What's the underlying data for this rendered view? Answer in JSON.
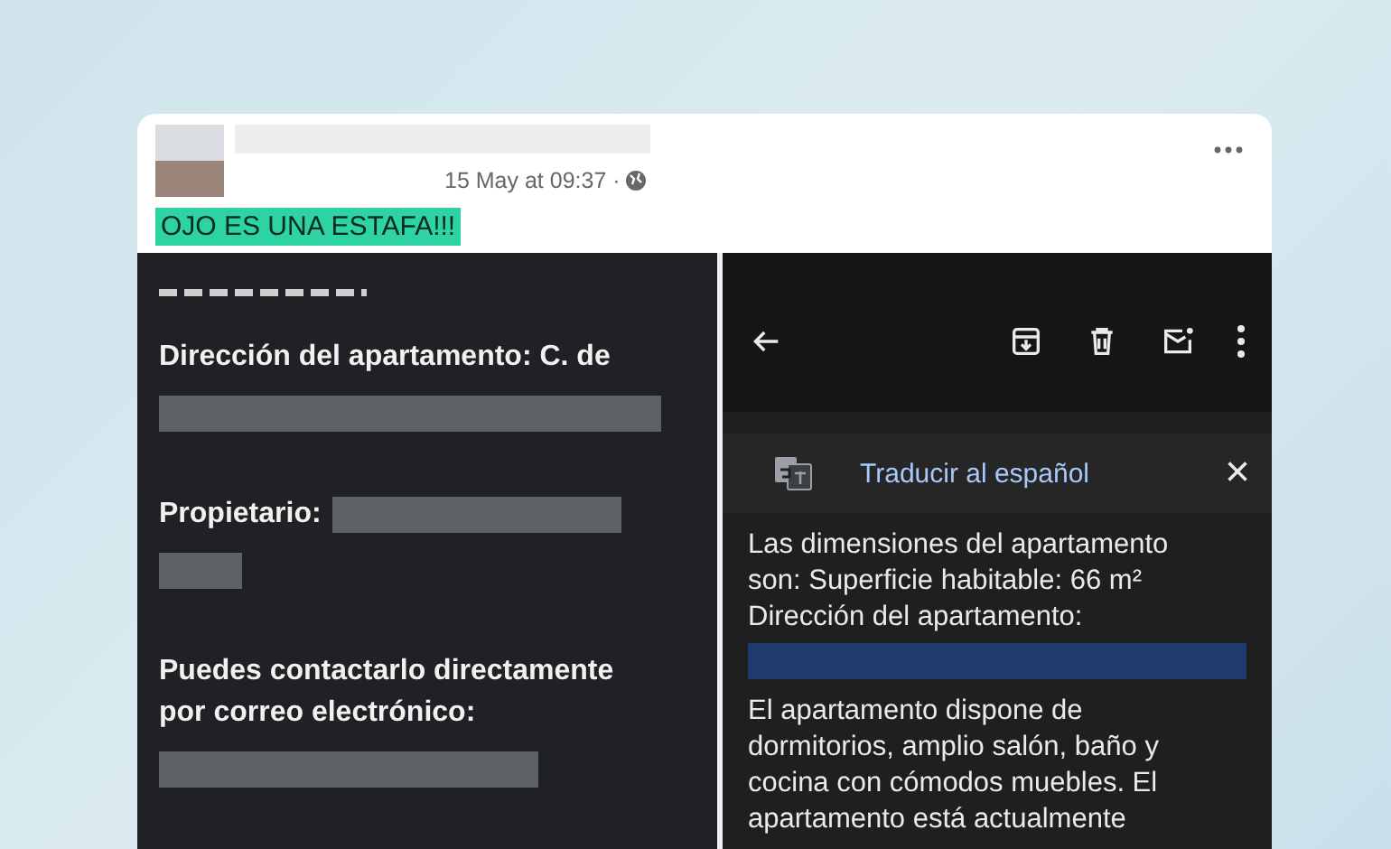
{
  "post": {
    "timestamp": "15 May at 09:37 ·",
    "caption": "OJO ES UNA ESTAFA!!!"
  },
  "left_screenshot": {
    "items": [
      {
        "kind": "below",
        "label": "Dirección del apartamento: C. de"
      },
      {
        "kind": "inline",
        "label": "Propietario:"
      },
      {
        "kind": "below",
        "label": "Puedes contactarlo directamente por correo electrónico:"
      }
    ]
  },
  "right_screenshot": {
    "translate_bar": {
      "label": "Traducir al español",
      "close": "×"
    },
    "paragraphs": [
      {
        "lines": [
          "Las dimensiones del apartamento",
          "son: Superficie habitable: 66 m²",
          "Dirección del apartamento:"
        ],
        "redacted_after": true
      },
      {
        "lines": [
          "El apartamento dispone de",
          "dormitorios, amplio salón, baño y",
          "cocina con cómodos muebles. El",
          "apartamento está actualmente"
        ],
        "redacted_after": false
      }
    ]
  }
}
